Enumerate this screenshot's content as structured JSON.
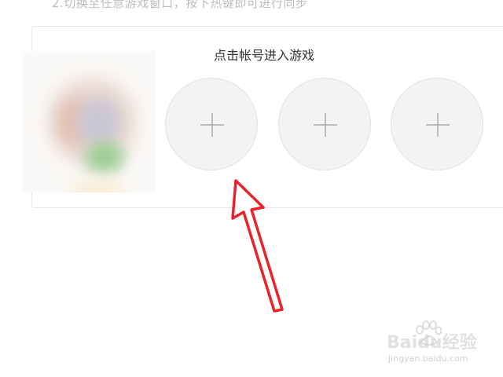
{
  "instructions": {
    "step_text": "2.切换至任意游戏窗口，按下热键即可进行同步"
  },
  "account_panel": {
    "title": "点击帐号进入游戏",
    "slots": [
      {
        "icon": "plus-icon"
      },
      {
        "icon": "plus-icon"
      },
      {
        "icon": "plus-icon"
      }
    ]
  },
  "annotation": {
    "arrow_color": "#e8232a"
  },
  "watermark": {
    "brand": "Baidu经验",
    "url": "jingyan.baidu.com"
  }
}
